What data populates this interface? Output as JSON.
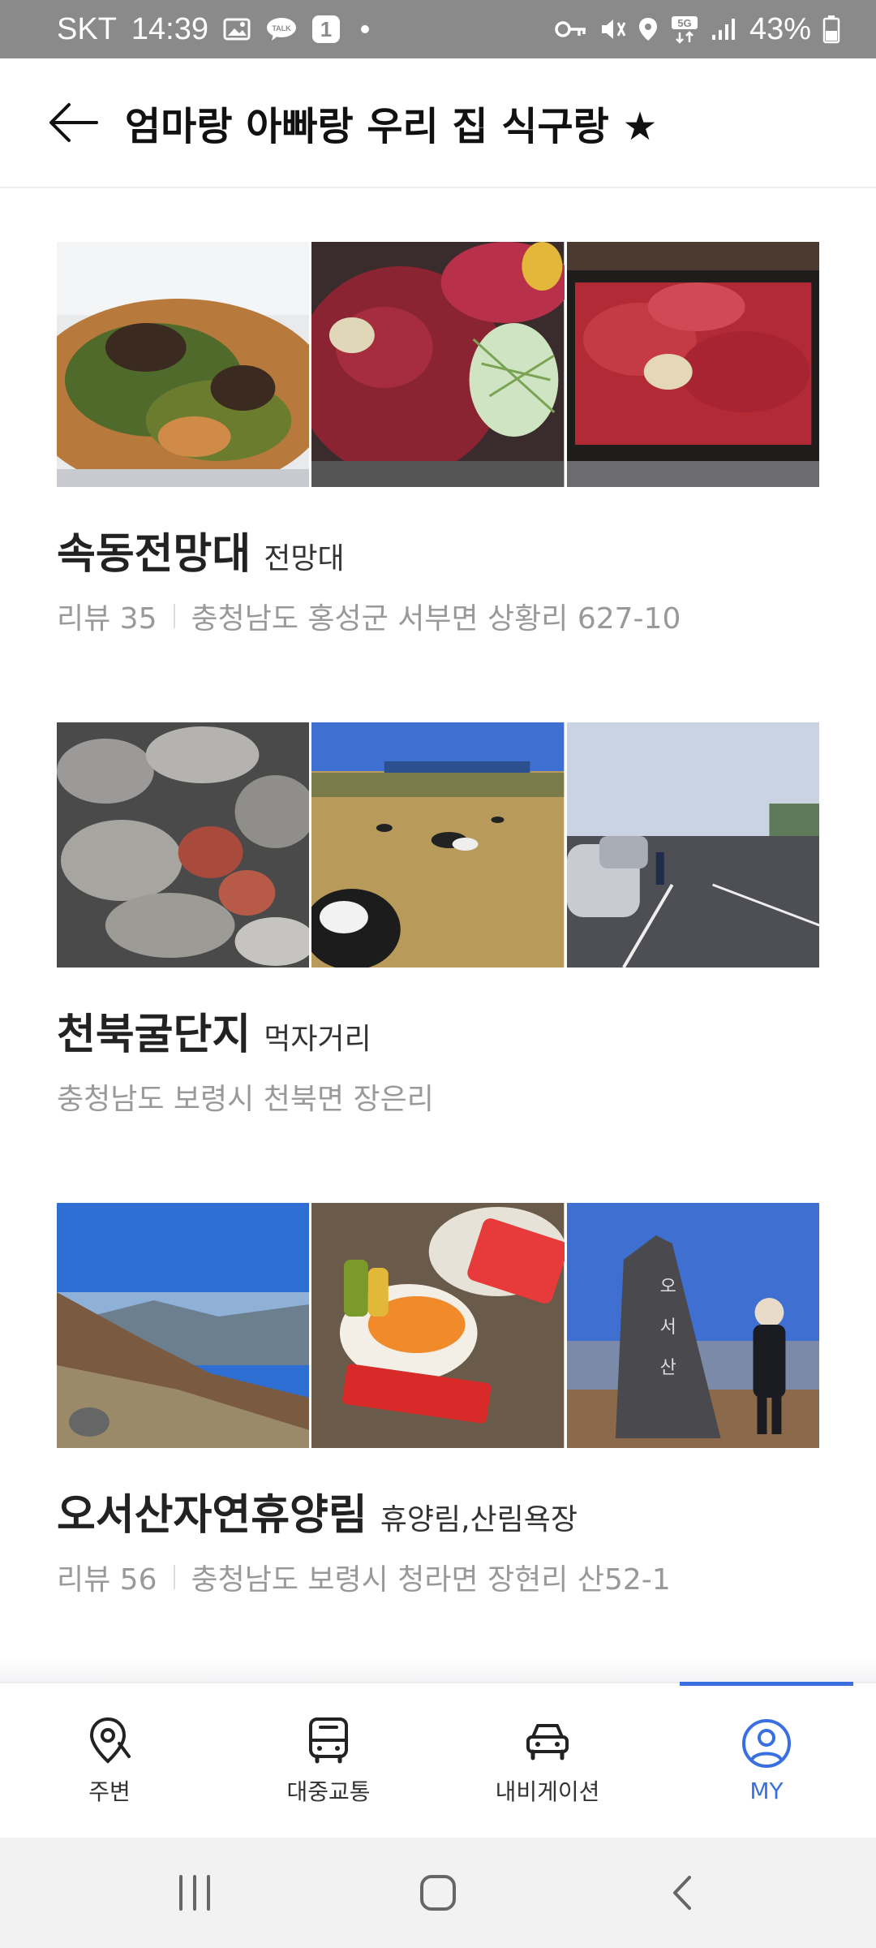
{
  "status_bar": {
    "carrier": "SKT",
    "time": "14:39",
    "notification_badge": "1",
    "network": "5G",
    "battery": "43%"
  },
  "header": {
    "title": "엄마랑 아빠랑 우리 집 식구랑 ★"
  },
  "places": [
    {
      "name": "속동전망대",
      "category": "전망대",
      "review_label": "리뷰 35",
      "address": "충청남도 홍성군 서부면 상황리 627-10",
      "photos": [
        "chive-pancake-photo",
        "raw-beef-photo",
        "beef-tray-photo"
      ]
    },
    {
      "name": "천북굴단지",
      "category": "먹자거리",
      "review_label": "",
      "address": "충청남도 보령시 천북면 장은리",
      "photos": [
        "grilled-oysters-photo",
        "cows-field-photo",
        "parking-lot-photo"
      ]
    },
    {
      "name": "오서산자연휴양림",
      "category": "휴양림,산림욕장",
      "review_label": "리뷰 56",
      "address": "충청남도 보령시 청라면 장현리 산52-1",
      "photos": [
        "mountain-view-photo",
        "noodles-snack-photo",
        "summit-stone-photo"
      ]
    }
  ],
  "tabbar": {
    "tabs": [
      {
        "label": "주변",
        "icon": "location-pin-icon"
      },
      {
        "label": "대중교통",
        "icon": "bus-icon"
      },
      {
        "label": "내비게이션",
        "icon": "car-icon"
      },
      {
        "label": "MY",
        "icon": "profile-icon"
      }
    ],
    "active_index": 3
  },
  "colors": {
    "accent": "#3a6fe0",
    "status_bar": "#8a8a8a",
    "meta_text": "#999999"
  }
}
